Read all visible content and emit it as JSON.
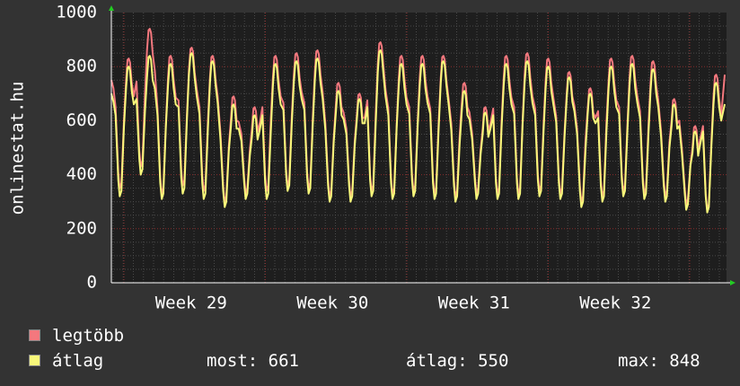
{
  "chart_data": {
    "type": "line",
    "ylabel": "onlinestat.hu",
    "ylim": [
      0,
      1000
    ],
    "y_ticks": [
      "1000",
      "800",
      "600",
      "400",
      "200",
      "0"
    ],
    "x_ticks": [
      "Week 29",
      "Week 30",
      "Week 31",
      "Week 32"
    ],
    "grid": true,
    "legend_placement": "bottom",
    "cycles_peaks_max": [
      830,
      940,
      840,
      870,
      840,
      690,
      650,
      840,
      850,
      860,
      740,
      700,
      890,
      840,
      840,
      840,
      740,
      650,
      840,
      850,
      830,
      780,
      720,
      830,
      840,
      820,
      680,
      580,
      770
    ],
    "cycles_troughs_max": [
      350,
      430,
      330,
      360,
      340,
      300,
      330,
      340,
      360,
      350,
      320,
      320,
      340,
      330,
      340,
      330,
      320,
      330,
      330,
      330,
      340,
      330,
      300,
      320,
      340,
      330,
      320,
      290,
      270
    ],
    "series": [
      {
        "name": "legtöbb",
        "color": "#f4787e",
        "peaks": [
          830,
          940,
          840,
          870,
          840,
          690,
          650,
          840,
          850,
          860,
          740,
          700,
          890,
          840,
          840,
          840,
          740,
          650,
          840,
          850,
          830,
          780,
          720,
          830,
          840,
          820,
          680,
          580,
          770
        ],
        "troughs": [
          350,
          430,
          330,
          360,
          340,
          300,
          330,
          340,
          360,
          350,
          320,
          320,
          340,
          330,
          340,
          330,
          320,
          330,
          330,
          330,
          340,
          330,
          300,
          320,
          340,
          330,
          320,
          290,
          270
        ]
      },
      {
        "name": "átlag",
        "color": "#f8f87a",
        "peaks": [
          800,
          840,
          810,
          850,
          820,
          660,
          620,
          810,
          820,
          830,
          710,
          680,
          860,
          810,
          810,
          820,
          710,
          630,
          810,
          820,
          800,
          760,
          700,
          800,
          810,
          790,
          660,
          560,
          740
        ],
        "troughs": [
          320,
          400,
          310,
          330,
          310,
          280,
          310,
          310,
          340,
          330,
          300,
          300,
          320,
          310,
          320,
          310,
          300,
          310,
          310,
          310,
          320,
          310,
          280,
          300,
          320,
          310,
          300,
          270,
          260
        ]
      }
    ],
    "start_value_max": 750,
    "start_value_avg": 700,
    "end_value_max": 770,
    "end_value_avg": 661
  },
  "legend": {
    "items": [
      {
        "label": "legtöbb",
        "color": "#f4787e"
      },
      {
        "label": "átlag",
        "color": "#f8f87a"
      }
    ],
    "stats": {
      "most": "most: 661",
      "atlag": "átlag: 550",
      "max": "max: 848"
    }
  },
  "colors": {
    "background": "#333333",
    "plot_background": "#1e1e1e",
    "grid_minor": "#4a4a4a",
    "grid_major": "#8a2a2a",
    "axis_arrow": "#22cc22"
  }
}
